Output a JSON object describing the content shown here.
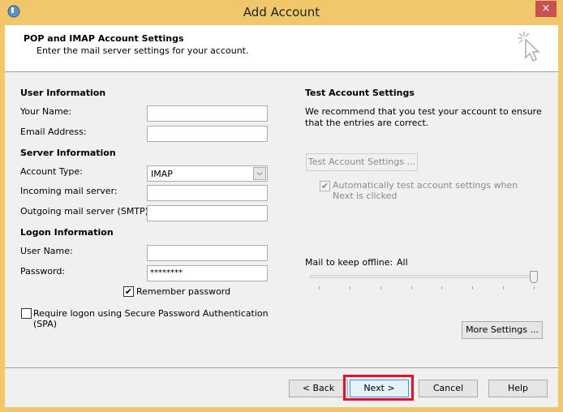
{
  "window": {
    "title": "Add Account",
    "close_label": "×"
  },
  "header": {
    "title": "POP and IMAP Account Settings",
    "subtitle": "Enter the mail server settings for your account."
  },
  "user_info": {
    "heading": "User Information",
    "name_label": "Your Name:",
    "name_value": "",
    "email_label": "Email Address:",
    "email_value": ""
  },
  "server_info": {
    "heading": "Server Information",
    "account_type_label": "Account Type:",
    "account_type_value": "IMAP",
    "incoming_label": "Incoming mail server:",
    "incoming_value": "",
    "outgoing_label": "Outgoing mail server (SMTP):",
    "outgoing_value": ""
  },
  "logon_info": {
    "heading": "Logon Information",
    "username_label": "User Name:",
    "username_value": "",
    "password_label": "Password:",
    "password_value": "********",
    "remember_label": "Remember password",
    "remember_checked": true,
    "spa_label": "Require logon using Secure Password Authentication (SPA)",
    "spa_checked": false
  },
  "test": {
    "heading": "Test Account Settings",
    "description": "We recommend that you test your account to ensure that the entries are correct.",
    "button": "Test Account Settings ...",
    "auto_label": "Automatically test account settings when Next is clicked",
    "auto_checked": true
  },
  "offline": {
    "label": "Mail to keep offline:",
    "value": "All",
    "slider_fraction": 1.0,
    "ticks": 8
  },
  "more_settings": "More Settings ...",
  "footer": {
    "back": "< Back",
    "next": "Next >",
    "cancel": "Cancel",
    "help": "Help"
  },
  "colors": {
    "frame": "#F0C86B",
    "close": "#C75050",
    "highlight": "#E81123"
  }
}
